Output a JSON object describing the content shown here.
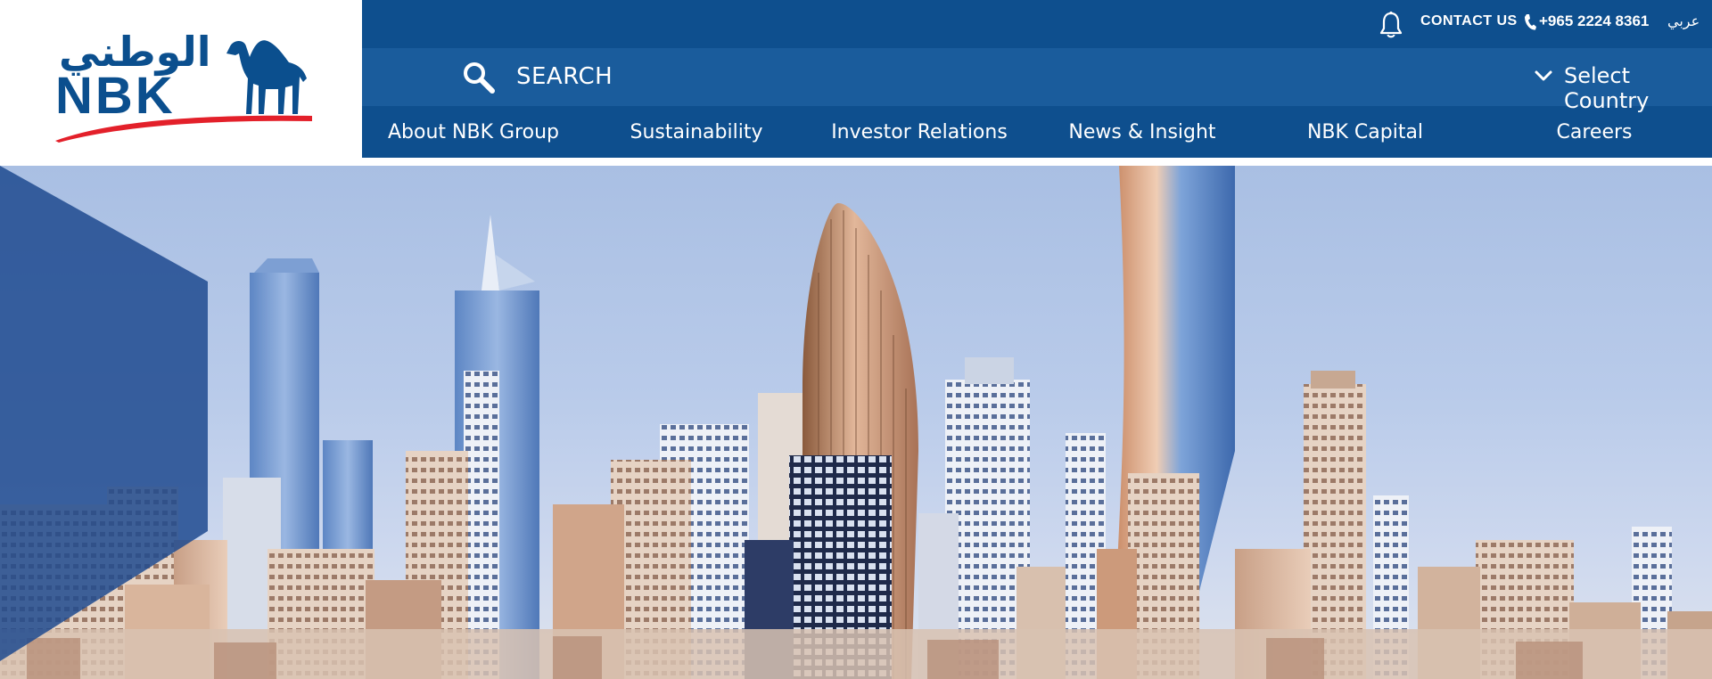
{
  "brand": {
    "logo_arabic": "الوطني",
    "logo_latin": "NBK",
    "primary_color": "#0e4f8e",
    "secondary_color": "#1a5c9c",
    "accent_color": "#e3202a"
  },
  "topbar": {
    "notifications_icon": "bell-icon",
    "contact_label": "CONTACT US",
    "phone_icon": "phone-icon",
    "phone_number": "+965 2224 8361",
    "language_label": "عربي"
  },
  "searchbar": {
    "search_icon": "search-icon",
    "search_label": "SEARCH",
    "country_icon": "chevron-down-icon",
    "country_label": "Select Country"
  },
  "nav": {
    "items": [
      {
        "label": "About NBK Group"
      },
      {
        "label": "Sustainability"
      },
      {
        "label": "Investor Relations"
      },
      {
        "label": "News & Insight"
      },
      {
        "label": "NBK Capital"
      },
      {
        "label": "Careers"
      }
    ]
  },
  "hero": {
    "image": "kuwait-city-skyline",
    "overlay_color": "#1f4a8f"
  }
}
